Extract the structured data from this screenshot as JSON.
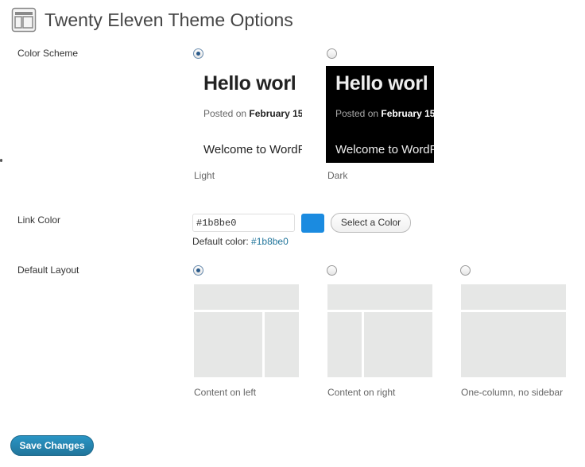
{
  "page": {
    "title": "Twenty Eleven Theme Options"
  },
  "color_scheme": {
    "label": "Color Scheme",
    "options": [
      {
        "caption": "Light",
        "selected": true,
        "preview_title": "Hello worl",
        "preview_posted_prefix": "Posted on",
        "preview_posted_date": "February 15",
        "preview_welcome": "Welcome to WordP"
      },
      {
        "caption": "Dark",
        "selected": false,
        "preview_title": "Hello worl",
        "preview_posted_prefix": "Posted on",
        "preview_posted_date": "February 15",
        "preview_welcome": "Welcome to WordP"
      }
    ]
  },
  "link_color": {
    "label": "Link Color",
    "value": "#1b8be0",
    "swatch_color": "#1b8be0",
    "select_button": "Select a Color",
    "default_label": "Default color:",
    "default_value": "#1b8be0"
  },
  "default_layout": {
    "label": "Default Layout",
    "options": [
      {
        "caption": "Content on left",
        "selected": true
      },
      {
        "caption": "Content on right",
        "selected": false
      },
      {
        "caption": "One-column, no sidebar",
        "selected": false
      }
    ]
  },
  "actions": {
    "save_label": "Save Changes"
  },
  "colors": {
    "accent": "#21759b",
    "layout_block": "#e6e7e6"
  },
  "icons": {
    "header": "layout-options-icon"
  }
}
